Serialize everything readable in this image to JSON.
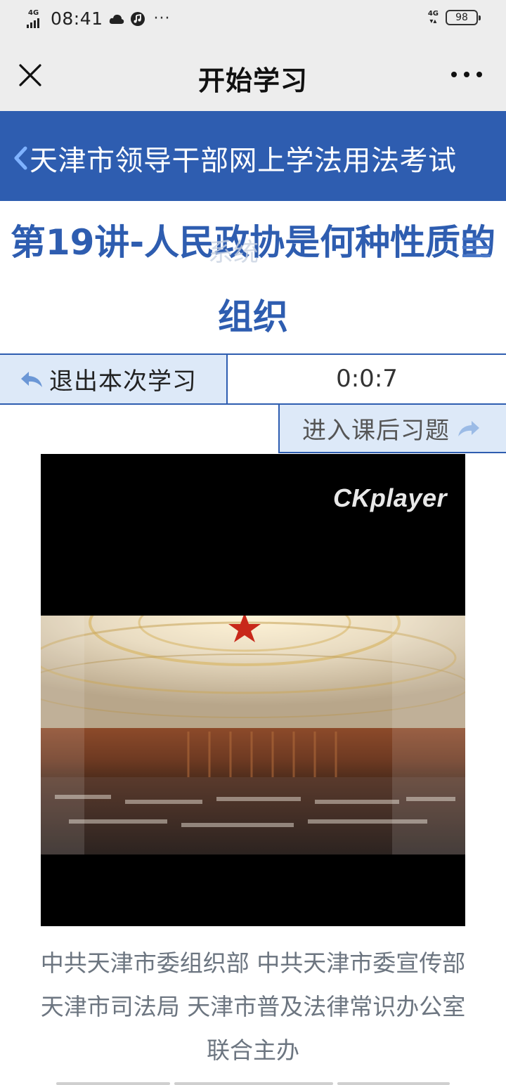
{
  "status_bar": {
    "network": "4G",
    "time": "08:41",
    "more": "···",
    "network_right": "4G",
    "battery": "98"
  },
  "title_bar": {
    "title": "开始学习"
  },
  "header": {
    "title": "天津市领导干部网上学法用法考试"
  },
  "lecture": {
    "title": "第19讲-人民政协是何种性质的组织",
    "overlay_text": "系统"
  },
  "controls": {
    "exit_label": "退出本次学习",
    "timer": "0:0:7",
    "exercise_label": "进入课后习题"
  },
  "video": {
    "player_logo": "CKplayer"
  },
  "footer": {
    "line1": "中共天津市委组织部 中共天津市委宣传部",
    "line2": "天津市司法局 天津市普及法律常识办公室",
    "line3": "联合主办"
  },
  "colors": {
    "brand_blue": "#2e5db0",
    "button_bg": "#dde9f8"
  }
}
